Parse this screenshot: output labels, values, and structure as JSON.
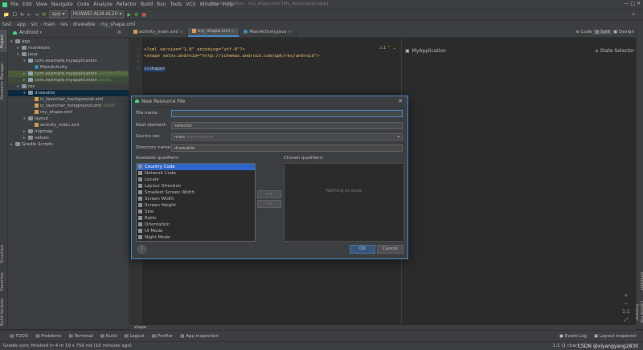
{
  "menu": [
    "File",
    "Edit",
    "View",
    "Navigate",
    "Code",
    "Analyze",
    "Refactor",
    "Build",
    "Run",
    "Tools",
    "VCS",
    "Window",
    "Help"
  ],
  "window_title": "My Application - my_shape.xml [My_Application.app]",
  "toolbar": {
    "run_config": "app",
    "device": "HUAWEI ALM-AL20"
  },
  "breadcrumbs": [
    "test",
    "app",
    "src",
    "main",
    "res",
    "drawable",
    "my_shape.xml"
  ],
  "project": {
    "view_label": "Android",
    "tree": [
      {
        "label": "app",
        "depth": 0,
        "type": "folder",
        "expanded": true,
        "cls": ""
      },
      {
        "label": "manifests",
        "depth": 1,
        "type": "folder",
        "expanded": false,
        "cls": ""
      },
      {
        "label": "java",
        "depth": 1,
        "type": "folder",
        "expanded": true,
        "cls": ""
      },
      {
        "label": "com.example.myapplication",
        "depth": 2,
        "type": "pkg",
        "expanded": true,
        "cls": ""
      },
      {
        "label": "MainActivity",
        "depth": 3,
        "type": "cls",
        "expanded": null,
        "cls": ""
      },
      {
        "label": "com.example.myapplication",
        "suffix": "(androidTest)",
        "depth": 2,
        "type": "pkg",
        "expanded": false,
        "cls": "hl"
      },
      {
        "label": "com.example.myapplication",
        "suffix": "(test)",
        "depth": 2,
        "type": "pkg",
        "expanded": false,
        "cls": "hl2"
      },
      {
        "label": "res",
        "depth": 1,
        "type": "folder",
        "expanded": true,
        "cls": ""
      },
      {
        "label": "drawable",
        "depth": 2,
        "type": "folder",
        "expanded": true,
        "cls": "sel"
      },
      {
        "label": "ic_launcher_background.xml",
        "depth": 3,
        "type": "xml",
        "expanded": null,
        "cls": ""
      },
      {
        "label": "ic_launcher_foreground.xml",
        "suffix": "(v24)",
        "depth": 3,
        "type": "xml",
        "expanded": null,
        "cls": ""
      },
      {
        "label": "my_shape.xml",
        "depth": 3,
        "type": "xml",
        "expanded": null,
        "cls": ""
      },
      {
        "label": "layout",
        "depth": 2,
        "type": "folder",
        "expanded": true,
        "cls": ""
      },
      {
        "label": "activity_main.xml",
        "depth": 3,
        "type": "xml",
        "expanded": null,
        "cls": ""
      },
      {
        "label": "mipmap",
        "depth": 2,
        "type": "folder",
        "expanded": false,
        "cls": ""
      },
      {
        "label": "values",
        "depth": 2,
        "type": "folder",
        "expanded": false,
        "cls": ""
      },
      {
        "label": "Gradle Scripts",
        "depth": 0,
        "type": "folder",
        "expanded": false,
        "cls": ""
      }
    ]
  },
  "editor_tabs": [
    {
      "label": "activity_main.xml",
      "active": false
    },
    {
      "label": "my_shape.xml",
      "active": true
    },
    {
      "label": "MainActivity.java",
      "active": false
    }
  ],
  "view_modes": {
    "code": "Code",
    "split": "Split",
    "design": "Design"
  },
  "code_lines": [
    {
      "num": "1",
      "text": "<?xml version=\"1.0\" encoding=\"utf-8\"?>"
    },
    {
      "num": "2",
      "text": "<shape xmlns:android=\"http://schemas.android.com/apk/res/android\">"
    },
    {
      "num": "3",
      "text": ""
    },
    {
      "num": "4",
      "text": "</shape>"
    }
  ],
  "warning_count": "1",
  "design": {
    "device": "MyApplication",
    "state_selector": "State Selector"
  },
  "breadcrumb_status": "shape",
  "dialog": {
    "title": "New Resource File",
    "file_name_label": "File name:",
    "file_name_value": "",
    "root_element_label": "Root element:",
    "root_element_value": "selector",
    "source_set_label": "Source set:",
    "source_set_value": "main",
    "source_set_path": "src/main/res",
    "directory_label": "Directory name:",
    "directory_value": "drawable",
    "available_label": "Available qualifiers:",
    "chosen_label": "Chosen qualifiers:",
    "nothing": "Nothing to show",
    "add_btn": ">>",
    "remove_btn": "<<",
    "qualifiers": [
      "Country Code",
      "Network Code",
      "Locale",
      "Layout Direction",
      "Smallest Screen Width",
      "Screen Width",
      "Screen Height",
      "Size",
      "Ratio",
      "Orientation",
      "UI Mode",
      "Night Mode"
    ],
    "ok": "OK",
    "cancel": "Cancel",
    "help": "?"
  },
  "bottom_tabs": [
    "TODO",
    "Problems",
    "Terminal",
    "Build",
    "Logcat",
    "Profiler",
    "App Inspection"
  ],
  "bottom_right": [
    "Event Log",
    "Layout Inspector"
  ],
  "status": "Gradle sync finished in 4 m 19 s 750 ms (10 minutes ago)",
  "status_right": "1:1 (1 char)",
  "watermark": "CSDN @xiyangyang2830",
  "left_tools": [
    "Project",
    "Resource Manager",
    "Structure",
    "Favorites",
    "Build Variants"
  ],
  "right_tools": [
    "Emulator",
    "Device File Explorer"
  ]
}
